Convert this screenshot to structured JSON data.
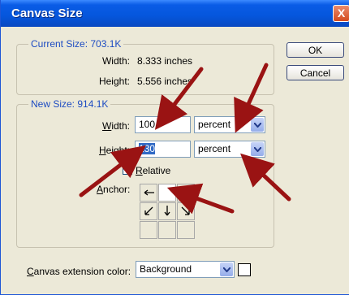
{
  "window": {
    "title": "Canvas Size",
    "close_glyph": "X"
  },
  "current_size": {
    "legend": "Current Size: 703.1K",
    "width_label": "Width:",
    "width_value": "8.333 inches",
    "height_label": "Height:",
    "height_value": "5.556 inches"
  },
  "new_size": {
    "legend": "New Size: 914.1K",
    "width_label_prefix": "W",
    "width_label_rest": "idth:",
    "width_value": "100",
    "width_unit": "percent",
    "height_label_prefix": "H",
    "height_label_rest": "eight:",
    "height_value": "130",
    "height_unit": "percent",
    "relative_label_prefix": "R",
    "relative_label_rest": "elative",
    "anchor_label_prefix": "A",
    "anchor_label_rest": "nchor:"
  },
  "buttons": {
    "ok": "OK",
    "cancel": "Cancel"
  },
  "extension": {
    "label_prefix": "C",
    "label_rest": "anvas extension color:",
    "value": "Background",
    "swatch_color": "#ffffff"
  },
  "annotation": {
    "arrow_color": "#9a1313"
  }
}
